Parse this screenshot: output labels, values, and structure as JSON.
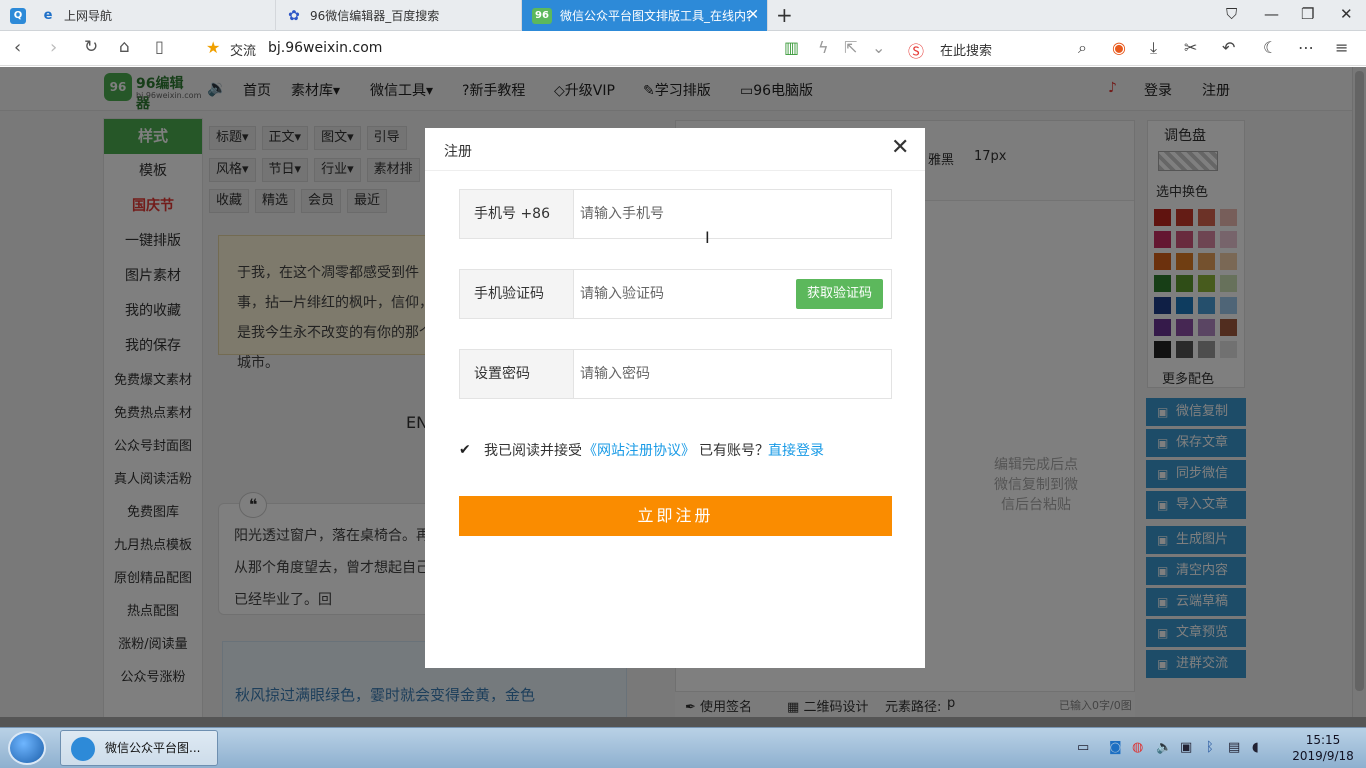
{
  "browser": {
    "tabs": [
      {
        "label": "上网导航",
        "icon": "q-icon"
      },
      {
        "label": "96微信编辑器_百度搜索",
        "icon": "baidu-paw-icon"
      },
      {
        "label": "微信公众平台图文排版工具_在线内容",
        "icon": "96-site-icon",
        "active": true
      }
    ],
    "address_label": "交流",
    "url": "bj.96weixin.com",
    "search_placeholder": "在此搜索"
  },
  "site": {
    "logo_title": "96编辑器",
    "logo_sub": "bj.96weixin.com",
    "nav": [
      "首页",
      "素材库▾",
      "微信工具▾",
      "新手教程",
      "升级VIP",
      "学习排版",
      "96电脑版"
    ],
    "login": "登录",
    "register": "注册",
    "side_menu": [
      {
        "label": "样式",
        "type": "head"
      },
      {
        "label": "模板"
      },
      {
        "label": "国庆节",
        "type": "red"
      },
      {
        "label": "一键排版"
      },
      {
        "label": "图片素材"
      },
      {
        "label": "我的收藏"
      },
      {
        "label": "我的保存"
      },
      {
        "label": "免费爆文素材",
        "type": "small"
      },
      {
        "label": "免费热点素材",
        "type": "small"
      },
      {
        "label": "公众号封面图",
        "type": "small"
      },
      {
        "label": "真人阅读活粉",
        "type": "small"
      },
      {
        "label": "免费图库",
        "type": "small"
      },
      {
        "label": "九月热点模板",
        "type": "small"
      },
      {
        "label": "原创精品配图",
        "type": "small"
      },
      {
        "label": "热点配图",
        "type": "small"
      },
      {
        "label": "涨粉/阅读量",
        "type": "small"
      },
      {
        "label": "公众号涨粉",
        "type": "small"
      }
    ],
    "filters_row1": [
      "标题▾",
      "正文▾",
      "图文▾",
      "引导"
    ],
    "filters_row2": [
      "风格▾",
      "节日▾",
      "行业▾",
      "素材排"
    ],
    "filters_row3": [
      "收藏",
      "精选",
      "会员",
      "最近"
    ],
    "card1_text": "于我，在这个凋零都感受到件事，拈一片绯红的枫叶，信仰，是我今生永不改变的有你的那个城市。",
    "card2_text": "阳光透过窗户，落在桌椅合。再从那个角度望去，曾才想起自己已经毕业了。回",
    "card3_text": "秋风掠过满眼绿色，霎时就会变得金黄，金色",
    "en_label": "EN",
    "editor_font": "雅黑",
    "editor_size": "17px",
    "editor_hint": "编辑完成后点微信复制到微信后台粘贴",
    "editor_foot": {
      "sign": "使用签名",
      "qr": "二维码设计",
      "path_label": "元素路径:",
      "path_value": "p",
      "count": "已输入0字/0图"
    },
    "palette": {
      "title": "调色盘",
      "pick": "选中换色",
      "more": "更多配色",
      "colors": [
        [
          "#c0261f",
          "#c8392b",
          "#d9644f",
          "#eebcb4"
        ],
        [
          "#c92f63",
          "#d2577d",
          "#dd8aa5",
          "#efc9d6"
        ],
        [
          "#d9631b",
          "#e07d25",
          "#e9a25d",
          "#f4d1ab"
        ],
        [
          "#2f7d2c",
          "#5f9a2f",
          "#8fb73b",
          "#cfe2b6"
        ],
        [
          "#1e3f8a",
          "#1d78bf",
          "#4a9fd8",
          "#9fcbef"
        ],
        [
          "#6a3594",
          "#8d4fa6",
          "#b58bc7",
          "#a35a3f"
        ],
        [
          "#222222",
          "#555555",
          "#9a9a9a",
          "#e2e2e2"
        ]
      ]
    },
    "right_buttons": [
      {
        "label": "微信复制",
        "icon": "copy-icon"
      },
      {
        "label": "保存文章",
        "icon": "save-icon"
      },
      {
        "label": "同步微信",
        "icon": "sync-icon"
      },
      {
        "label": "导入文章",
        "icon": "import-icon"
      },
      {
        "label": "生成图片",
        "icon": "image-icon"
      },
      {
        "label": "清空内容",
        "icon": "trash-icon"
      },
      {
        "label": "云端草稿",
        "icon": "draft-icon"
      },
      {
        "label": "文章预览",
        "icon": "eye-icon"
      },
      {
        "label": "进群交流",
        "icon": "group-icon"
      }
    ]
  },
  "modal": {
    "title": "注册",
    "phone_label": "手机号  +86",
    "phone_placeholder": "请输入手机号",
    "code_label": "手机验证码",
    "code_placeholder": "请输入验证码",
    "code_button": "获取验证码",
    "password_label": "设置密码",
    "password_placeholder": "请输入密码",
    "agree_text": "我已阅读并接受",
    "agreement_link": "《网站注册协议》",
    "have_account": "已有账号？",
    "login_link": "直接登录",
    "submit": "立即注册",
    "agree_checked": true
  },
  "taskbar": {
    "app_label": "微信公众平台图...",
    "time": "15:15",
    "date": "2019/9/18"
  }
}
